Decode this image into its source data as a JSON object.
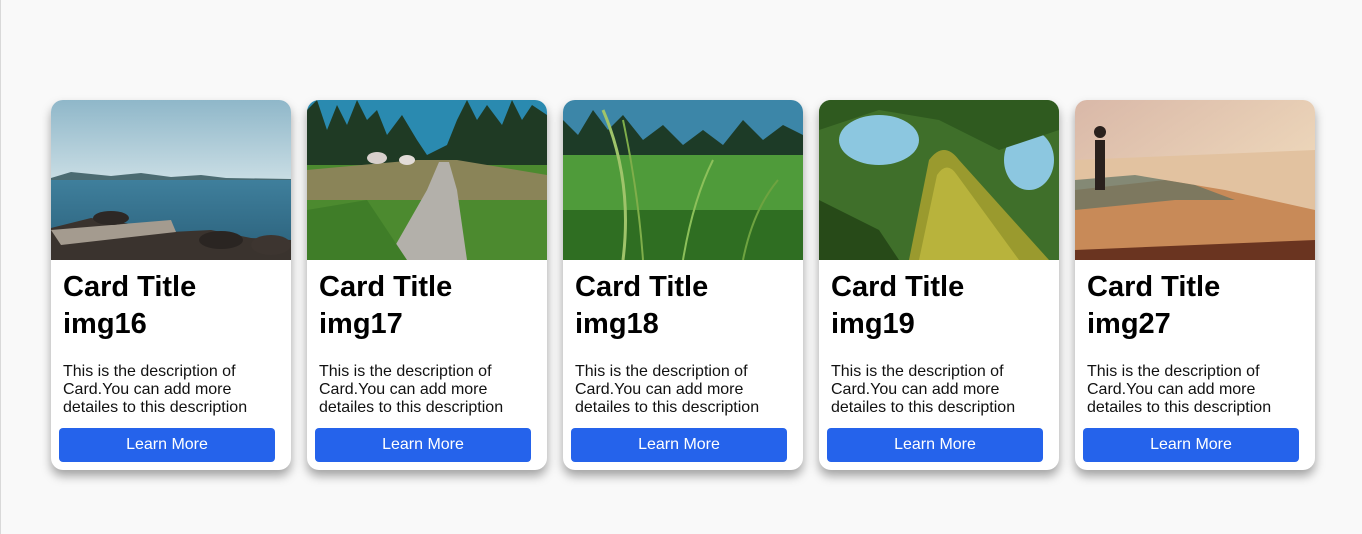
{
  "cards": [
    {
      "image": "sea-rocks-image",
      "title_line1": "Card Title",
      "title_line2": "img16",
      "description": "This is the description of Card.You can add more detailes to this description",
      "button_label": "Learn More"
    },
    {
      "image": "forest-path-image",
      "title_line1": "Card Title",
      "title_line2": "img17",
      "description": "This is the description of Card.You can add more detailes to this description",
      "button_label": "Learn More"
    },
    {
      "image": "grass-field-image",
      "title_line1": "Card Title",
      "title_line2": "img18",
      "description": "This is the description of Card.You can add more detailes to this description",
      "button_label": "Learn More"
    },
    {
      "image": "mossy-log-image",
      "title_line1": "Card Title",
      "title_line2": "img19",
      "description": "This is the description of Card.You can add more detailes to this description",
      "button_label": "Learn More"
    },
    {
      "image": "coast-sunset-image",
      "title_line1": "Card Title",
      "title_line2": "img27",
      "description": "This is the description of Card.You can add more detailes to this description",
      "button_label": "Learn More"
    }
  ],
  "colors": {
    "button": "#2563eb",
    "page_background": "#f9f9f9"
  }
}
